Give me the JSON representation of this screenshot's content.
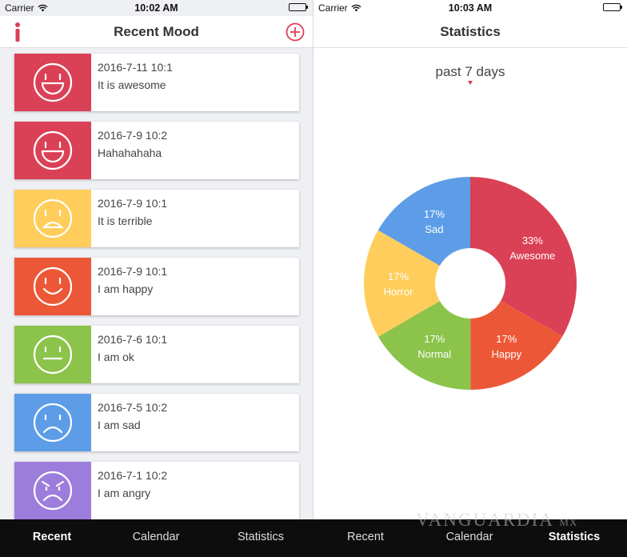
{
  "left": {
    "status": {
      "carrier": "Carrier",
      "time": "10:02 AM"
    },
    "title": "Recent Mood",
    "entries": [
      {
        "date": "2016-7-11 10:1",
        "note": "It is awesome",
        "mood": "awesome",
        "color": "#db4156",
        "face": "laugh"
      },
      {
        "date": "2016-7-9 10:2",
        "note": "Hahahahaha",
        "mood": "awesome",
        "color": "#db4156",
        "face": "laugh"
      },
      {
        "date": "2016-7-9 10:1",
        "note": "It is terrible",
        "mood": "horror",
        "color": "#fecd5b",
        "face": "horror"
      },
      {
        "date": "2016-7-9 10:1",
        "note": "I am happy",
        "mood": "happy",
        "color": "#ec5837",
        "face": "happy"
      },
      {
        "date": "2016-7-6 10:1",
        "note": "I am ok",
        "mood": "normal",
        "color": "#8cc34b",
        "face": "neutral"
      },
      {
        "date": "2016-7-5 10:2",
        "note": "I am sad",
        "mood": "sad",
        "color": "#5d9de8",
        "face": "sad"
      },
      {
        "date": "2016-7-1 10:2",
        "note": "I am angry",
        "mood": "angry",
        "color": "#9c7ddc",
        "face": "angry"
      }
    ]
  },
  "right": {
    "status": {
      "carrier": "Carrier",
      "time": "10:03 AM"
    },
    "title": "Statistics",
    "range": "past 7 days",
    "slices": [
      {
        "pct": "33%",
        "label": "Awesome",
        "value": 33.3,
        "color": "#db4156"
      },
      {
        "pct": "17%",
        "label": "Happy",
        "value": 16.7,
        "color": "#ec5837"
      },
      {
        "pct": "17%",
        "label": "Normal",
        "value": 16.7,
        "color": "#8cc34b"
      },
      {
        "pct": "17%",
        "label": "Horror",
        "value": 16.7,
        "color": "#fecd5b"
      },
      {
        "pct": "17%",
        "label": "Sad",
        "value": 16.7,
        "color": "#5d9de8"
      }
    ]
  },
  "tabs": {
    "left": [
      {
        "label": "Recent",
        "active": true
      },
      {
        "label": "Calendar",
        "active": false
      },
      {
        "label": "Statistics",
        "active": false
      }
    ],
    "right": [
      {
        "label": "Recent",
        "active": false
      },
      {
        "label": "Calendar",
        "active": false
      },
      {
        "label": "Statistics",
        "active": true
      }
    ]
  },
  "watermark": {
    "brand": "VANGUARDIA",
    "suffix": "MX"
  },
  "accent": "#db4156",
  "icons": {
    "info": "info-icon",
    "add": "add-circle-icon",
    "wifi": "wifi-icon",
    "battery": "battery-icon",
    "caret": "caret-down-icon"
  }
}
